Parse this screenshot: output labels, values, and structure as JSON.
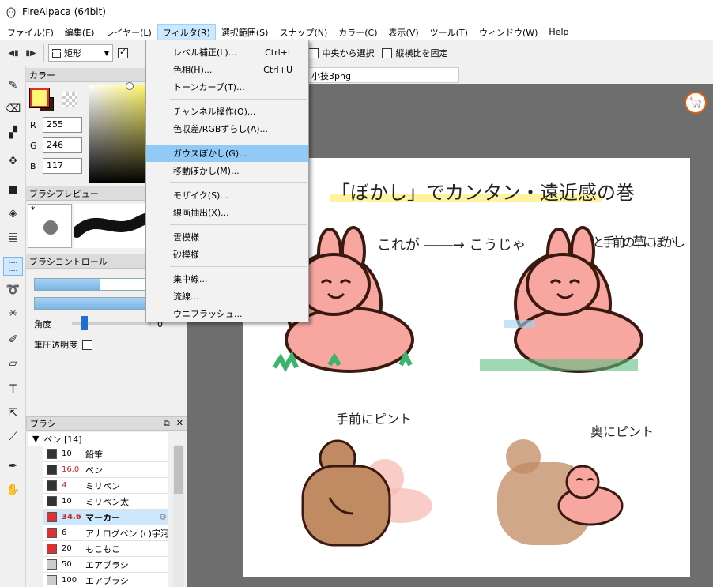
{
  "window": {
    "title": "FireAlpaca (64bit)"
  },
  "menubar": [
    "ファイル(F)",
    "編集(E)",
    "レイヤー(L)",
    "フィルタ(R)",
    "選択範囲(S)",
    "スナップ(N)",
    "カラー(C)",
    "表示(V)",
    "ツール(T)",
    "ウィンドウ(W)",
    "Help"
  ],
  "toolbar": {
    "shape_label": "矩形",
    "pct_suffix": "%",
    "center_select": "中央から選択",
    "fix_ratio": "縦横比を固定"
  },
  "filter_menu": {
    "groups": [
      [
        {
          "label": "レベル補正(L)...",
          "shortcut": "Ctrl+L"
        },
        {
          "label": "色相(H)...",
          "shortcut": "Ctrl+U"
        },
        {
          "label": "トーンカーブ(T)...",
          "shortcut": ""
        }
      ],
      [
        {
          "label": "チャンネル操作(O)...",
          "shortcut": ""
        },
        {
          "label": "色収差/RGBずらし(A)...",
          "shortcut": ""
        }
      ],
      [
        {
          "label": "ガウスぼかし(G)...",
          "shortcut": "",
          "highlighted": true
        },
        {
          "label": "移動ぼかし(M)...",
          "shortcut": ""
        }
      ],
      [
        {
          "label": "モザイク(S)...",
          "shortcut": ""
        },
        {
          "label": "線画抽出(X)...",
          "shortcut": ""
        }
      ],
      [
        {
          "label": "雲模様",
          "shortcut": ""
        },
        {
          "label": "砂模様",
          "shortcut": ""
        }
      ],
      [
        {
          "label": "集中線...",
          "shortcut": ""
        },
        {
          "label": "流線...",
          "shortcut": ""
        },
        {
          "label": "ウニフラッシュ...",
          "shortcut": ""
        }
      ]
    ]
  },
  "color_panel": {
    "title": "カラー",
    "r_label": "R",
    "g_label": "G",
    "b_label": "B",
    "r": "255",
    "g": "246",
    "b": "117",
    "fg_color": "#fff675",
    "bg_color": "#3a1a10"
  },
  "brush_preview": {
    "title": "ブラシプレビュー",
    "marker": "*"
  },
  "brush_control": {
    "title": "ブラシコントロール",
    "size_level": 0.58,
    "opacity_level": 1.0,
    "angle_label": "角度",
    "angle_value": "0",
    "pressure_label": "筆圧透明度"
  },
  "brush_list": {
    "title": "ブラシ",
    "group_label": "ペン [14]",
    "items": [
      {
        "size": "10",
        "name": "鉛筆",
        "color": "#333333",
        "red_size": false
      },
      {
        "size": "16.0",
        "name": "ペン",
        "color": "#333333",
        "red_size": true
      },
      {
        "size": "4",
        "name": "ミリペン",
        "color": "#333333",
        "red_size": true
      },
      {
        "size": "10",
        "name": "ミリペン太",
        "color": "#333333",
        "red_size": false
      },
      {
        "size": "34.6",
        "name": "マーカー",
        "color": "#e03030",
        "red_size": true,
        "selected": true
      },
      {
        "size": "6",
        "name": "アナログペン (c)宇河弘",
        "color": "#e03030",
        "red_size": false
      },
      {
        "size": "20",
        "name": "もこもこ",
        "color": "#e03030",
        "red_size": false
      },
      {
        "size": "50",
        "name": "エアブラシ",
        "color": "#cccccc",
        "red_size": false
      },
      {
        "size": "100",
        "name": "エアブラシ",
        "color": "#cccccc",
        "red_size": false
      }
    ]
  },
  "canvas": {
    "tab_name": "小技3png",
    "illustration": {
      "heading": "「ぼかし」でカンタン・遠近感の巻",
      "before_after": "これが ――→ こうじゃ",
      "note_top": "奥と手前の草にぼかし",
      "note_front": "手前にピント",
      "note_back": "奥にピント"
    }
  },
  "icons": {
    "tools": [
      "pen-icon",
      "eraser-icon",
      "dot-icon",
      "move-icon",
      "fill-rect-icon",
      "bucket-icon",
      "gradient-icon",
      "select-rect-icon",
      "lasso-icon",
      "magic-wand-icon",
      "select-pen-icon",
      "select-eraser-icon",
      "text-icon",
      "operation-icon",
      "eyedropper-icon",
      "color-picker-icon",
      "hand-icon"
    ]
  }
}
